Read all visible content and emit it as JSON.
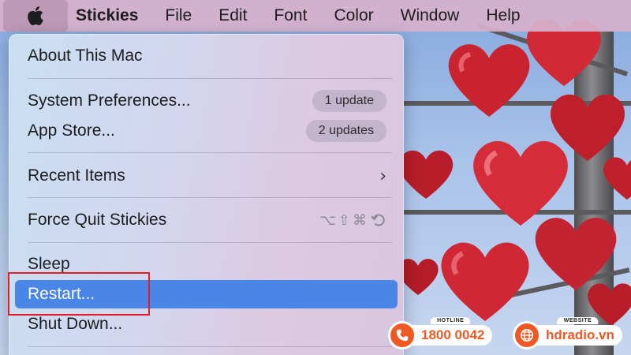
{
  "menubar": {
    "apple_icon": "apple-icon",
    "app_name": "Stickies",
    "items": [
      "File",
      "Edit",
      "Font",
      "Color",
      "Window",
      "Help"
    ]
  },
  "apple_menu": {
    "about": "About This Mac",
    "system_prefs": {
      "label": "System Preferences...",
      "badge": "1 update"
    },
    "app_store": {
      "label": "App Store...",
      "badge": "2 updates"
    },
    "recent_items": {
      "label": "Recent Items",
      "icon": "chevron-right-icon"
    },
    "force_quit": {
      "label": "Force Quit Stickies",
      "shortcut": "⌥⇧⌘"
    },
    "sleep": "Sleep",
    "restart": "Restart...",
    "shut_down": "Shut Down...",
    "highlight_color": "#4a86e8",
    "annotation_color": "#e21f26"
  },
  "promo": {
    "hotline_caption": "HOTLINE",
    "hotline_number": "1800 0042",
    "website_caption": "WEBSITE",
    "website_url": "hdradio.vn",
    "accent_color": "#ef5a24"
  }
}
